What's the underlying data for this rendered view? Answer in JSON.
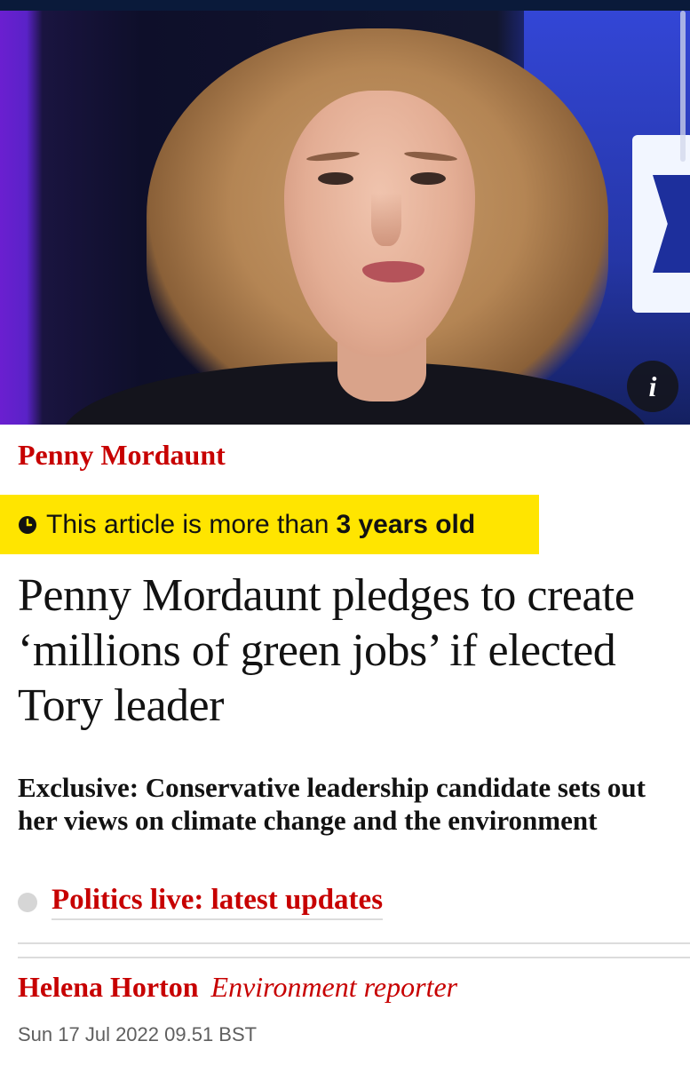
{
  "hero": {
    "image_subject": "portrait photo",
    "info_icon": "info-icon",
    "info_label": "i"
  },
  "article": {
    "kicker": "Penny Mordaunt",
    "age_warning": {
      "icon": "clock-icon",
      "text": "This article is more than",
      "emphasis": "3 years old"
    },
    "headline": "Penny Mordaunt pledges to create ‘millions of green jobs’ if elected Tory leader",
    "standfirst": "Exclusive: Conservative leadership candidate sets out her views on climate change and the environment",
    "related_link": "Politics live: latest updates",
    "byline": {
      "name": "Helena Horton",
      "role": "Environment reporter"
    },
    "dateline": "Sun 17 Jul 2022 09.51 BST"
  },
  "colors": {
    "accent_red": "#c70000",
    "warning_yellow": "#ffe500",
    "text": "#121212"
  }
}
